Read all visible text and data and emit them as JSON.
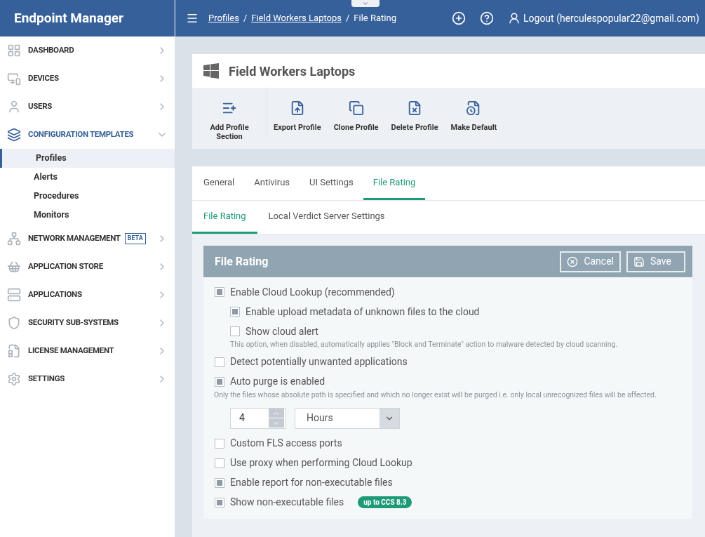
{
  "app": {
    "title": "Endpoint Manager"
  },
  "header": {
    "breadcrumbs": [
      {
        "label": "Profiles",
        "link": true
      },
      {
        "label": "Field Workers Laptops",
        "link": true
      },
      {
        "label": "File Rating",
        "link": false
      }
    ],
    "separator": "/",
    "user": "Logout (herculespopular22@gmail.com)"
  },
  "sidebar": {
    "items": [
      {
        "label": "DASHBOARD",
        "expanded": false
      },
      {
        "label": "DEVICES",
        "expanded": false
      },
      {
        "label": "USERS",
        "expanded": false
      },
      {
        "label": "CONFIGURATION TEMPLATES",
        "expanded": true,
        "children": [
          {
            "label": "Profiles",
            "selected": true
          },
          {
            "label": "Alerts",
            "selected": false
          },
          {
            "label": "Procedures",
            "selected": false
          },
          {
            "label": "Monitors",
            "selected": false
          }
        ]
      },
      {
        "label": "NETWORK MANAGEMENT",
        "expanded": false,
        "badge": "BETA"
      },
      {
        "label": "APPLICATION STORE",
        "expanded": false
      },
      {
        "label": "APPLICATIONS",
        "expanded": false
      },
      {
        "label": "SECURITY SUB-SYSTEMS",
        "expanded": false
      },
      {
        "label": "LICENSE MANAGEMENT",
        "expanded": false
      },
      {
        "label": "SETTINGS",
        "expanded": false
      }
    ]
  },
  "profile": {
    "title": "Field Workers Laptops",
    "toolbar": [
      {
        "label": "Add Profile Section"
      },
      {
        "label": "Export Profile"
      },
      {
        "label": "Clone Profile"
      },
      {
        "label": "Delete Profile"
      },
      {
        "label": "Make Default"
      }
    ]
  },
  "tabs": [
    {
      "label": "General",
      "selected": false
    },
    {
      "label": "Antivirus",
      "selected": false
    },
    {
      "label": "UI Settings",
      "selected": false
    },
    {
      "label": "File Rating",
      "selected": true
    }
  ],
  "subtabs": [
    {
      "label": "File Rating",
      "selected": true
    },
    {
      "label": "Local Verdict Server Settings",
      "selected": false
    }
  ],
  "section": {
    "title": "File Rating",
    "buttons": [
      {
        "label": "Cancel"
      },
      {
        "label": "Save"
      }
    ],
    "options": [
      {
        "kind": "checkbox",
        "label": "Enable Cloud Lookup (recommended)",
        "checked": true,
        "children": [
          {
            "kind": "checkbox",
            "label": "Enable upload metadata of unknown files to the cloud",
            "checked": true
          },
          {
            "kind": "checkbox",
            "label": "Show cloud alert",
            "checked": false,
            "note": "This option, when disabled, automatically applies \"Block and Terminate\" action to malware detected by cloud scanning."
          }
        ]
      },
      {
        "kind": "checkbox",
        "label": "Detect potentially unwanted applications",
        "checked": false
      },
      {
        "kind": "checkbox",
        "label": "Auto purge is enabled",
        "checked": true,
        "note": "Only the files whose absolute path is specified and which no longer exist will be purged i.e. only local unrecognized files will be affected."
      },
      {
        "kind": "interval",
        "value": "4",
        "unit": "Hours"
      },
      {
        "kind": "checkbox",
        "label": "Custom FLS access ports",
        "checked": false
      },
      {
        "kind": "checkbox",
        "label": "Use proxy when performing Cloud Lookup",
        "checked": false
      },
      {
        "kind": "checkbox",
        "label": "Enable report for non-executable files",
        "checked": true
      },
      {
        "kind": "checkbox",
        "label": "Show non-executable files",
        "checked": true,
        "badge": "up to CCS 8.3"
      }
    ]
  }
}
